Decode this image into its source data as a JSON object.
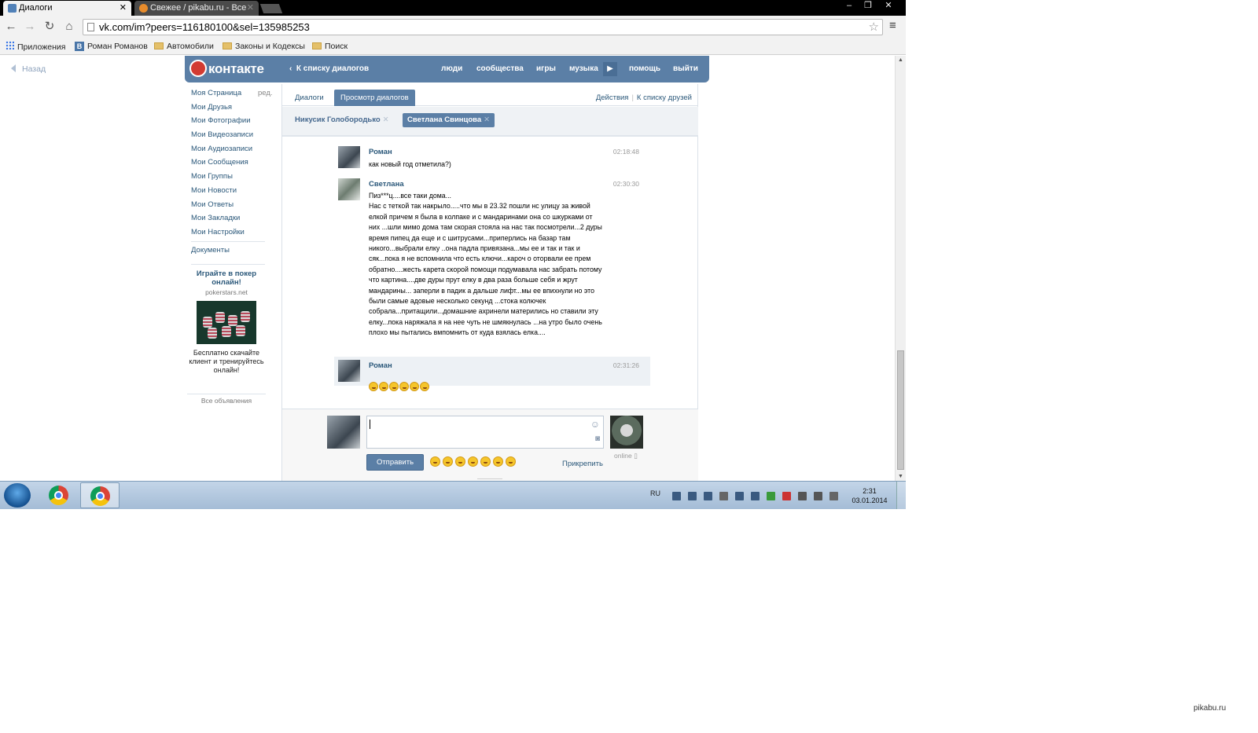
{
  "browser": {
    "tabs": [
      {
        "title": "Диалоги",
        "close": "✕"
      },
      {
        "title": "Свежее / pikabu.ru - Все",
        "close": "✕"
      }
    ],
    "url": "vk.com/im?peers=116180100&sel=135985253",
    "bookmarks": [
      "Приложения",
      "Роман Романов",
      "Автомобили",
      "Законы и Кодексы",
      "Поиск"
    ]
  },
  "page": {
    "back": "Назад",
    "header": {
      "logo": "контакте",
      "to_dialogs": "К списку диалогов",
      "nav": [
        "люди",
        "сообщества",
        "игры",
        "музыка",
        "помощь",
        "выйти"
      ]
    },
    "left_menu": {
      "items": [
        "Моя Страница",
        "Мои Друзья",
        "Мои Фотографии",
        "Мои Видеозаписи",
        "Мои Аудиозаписи",
        "Мои Сообщения",
        "Мои Группы",
        "Мои Новости",
        "Мои Ответы",
        "Мои Закладки",
        "Мои Настройки"
      ],
      "edit": "ред.",
      "documents": "Документы",
      "ad": {
        "title": "Играйте в покер онлайн!",
        "domain": "pokerstars.net",
        "body": "Бесплатно скачайте клиент и тренируйтесь онлайн!",
        "all_ads": "Все объявления"
      }
    },
    "tabs": {
      "dialogs": "Диалоги",
      "view": "Просмотр диалогов",
      "actions": "Действия",
      "to_friends": "К списку друзей"
    },
    "peers": [
      "Никусик Голобородько",
      "Светлана Свинцова"
    ],
    "messages": [
      {
        "author": "Роман",
        "time": "02:18:48",
        "text": "как новый год отметила?)"
      },
      {
        "author": "Светлана",
        "time": "02:30:30",
        "text": "Пиз***ц....все таки дома...\nНас с теткой так накрыло.....что мы в 23.32 пошли нс улицу за живой елкой причем я была в колпаке и с мандаринами она со шкурками от них ...шли мимо дома там скорая стояла на нас так посмотрели...2 дуры время пипец да еще и с шитрусами...приперлись на базар там никого...выбрали елку ..она падла привязана...мы ее и так и так и сяк...пока я не вспомнила что есть ключи...кароч о оторвали ее прем обратно....жесть карета скорой помощи подумавала нас забрать потому что картина....две дуры прут елку в два раза больше себя и жрут мандарины... заперли в падик а дальше лифт...мы ее впихнули но это были самые адовые несколько секунд ...стока колючек собрала...притащили...домашние ахринели матерились но ставили эту елку...пока наряжала я на нее чуть не шмякнулась ...на утро было очень плохо мы пытались вмпомнить от куда взялась елка...."
      },
      {
        "author": "Роман",
        "time": "02:31:26",
        "smiles": 6
      }
    ],
    "composer": {
      "send": "Отправить",
      "attach": "Прикрепить",
      "online": "online"
    }
  },
  "taskbar": {
    "lang": "RU",
    "time": "2:31",
    "date": "03.01.2014"
  },
  "watermark": "pikabu.ru"
}
